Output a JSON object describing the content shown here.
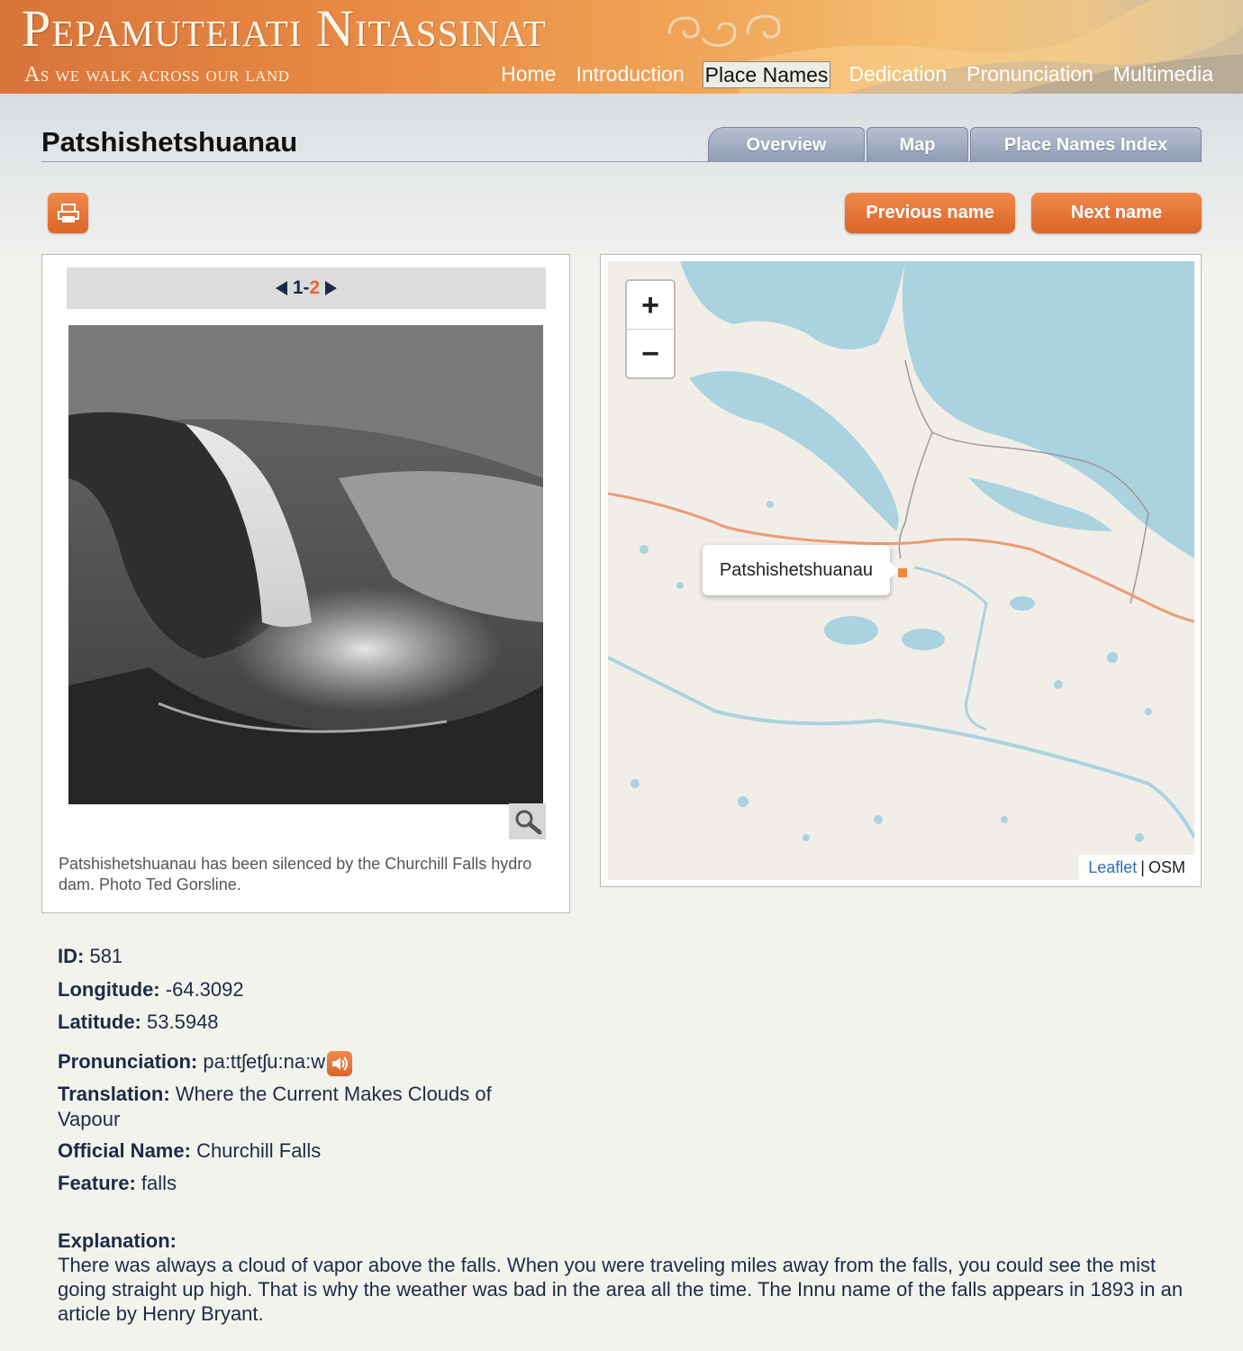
{
  "header": {
    "site_title": "Pepamuteiati Nitassinat",
    "site_subtitle": "As we walk across our land",
    "nav": [
      {
        "label": "Home",
        "active": false
      },
      {
        "label": "Introduction",
        "active": false
      },
      {
        "label": "Place Names",
        "active": true
      },
      {
        "label": "Dedication",
        "active": false
      },
      {
        "label": "Pronunciation",
        "active": false
      },
      {
        "label": "Multimedia",
        "active": false
      }
    ]
  },
  "page": {
    "title": "Patshishetshuanau",
    "tabs": [
      "Overview",
      "Map",
      "Place Names Index"
    ],
    "print_icon": "printer-icon",
    "previous_label": "Previous name",
    "next_label": "Next name"
  },
  "gallery": {
    "pager_first": "1",
    "pager_sep": "-",
    "pager_current": "2",
    "photo_alt": "Aerial black and white photograph of a waterfall in a forested gorge",
    "zoom_icon": "magnifier-icon",
    "caption": "Patshishetshuanau has been silenced by the Churchill Falls hydro dam. Photo Ted Gorsline."
  },
  "map": {
    "zoom_in": "+",
    "zoom_out": "−",
    "popup_label": "Patshishetshuanau",
    "attribution_link": "Leaflet",
    "attribution_sep": "|",
    "attribution_text": "OSM",
    "colors": {
      "water": "#aad3df",
      "land": "#f1eee9",
      "road": "#ef9a75",
      "marker": "#ef8a3c"
    }
  },
  "details": {
    "id_label": "ID:",
    "id_value": "581",
    "longitude_label": "Longitude:",
    "longitude_value": "-64.3092",
    "latitude_label": "Latitude:",
    "latitude_value": "53.5948",
    "pronunciation_label": "Pronunciation:",
    "pronunciation_value": "pa:ttʃetʃu:na:w",
    "translation_label": "Translation:",
    "translation_value": "Where the Current Makes Clouds of Vapour",
    "official_label": "Official Name:",
    "official_value": "Churchill Falls",
    "feature_label": "Feature:",
    "feature_value": "falls",
    "explanation_label": "Explanation:",
    "explanation_value": "There was always a cloud of vapor above the falls. When you were traveling miles away from the falls, you could see the mist going straight up high. That is why the weather was bad in the area all the time. The Innu name of the falls appears in 1893 in an article by Henry Bryant."
  },
  "colors": {
    "accent": "#e06a2c",
    "text": "#1f2a44",
    "tab": "#9aa4bb"
  }
}
